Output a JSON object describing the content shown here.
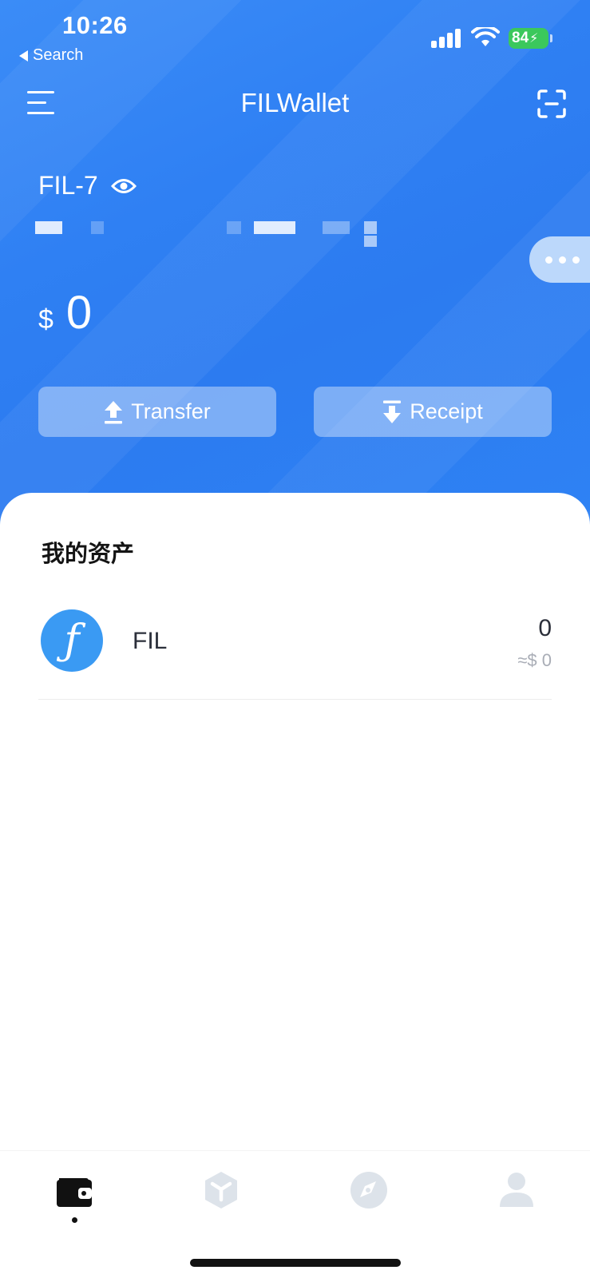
{
  "status_bar": {
    "time": "10:26",
    "back_label": "Search",
    "battery": "84"
  },
  "header": {
    "title": "FILWallet",
    "menu_icon": "menu-icon",
    "scan_icon": "scan-icon"
  },
  "account": {
    "name": "FIL-7",
    "visibility_icon": "eye-icon",
    "currency_symbol": "$",
    "balance": "0"
  },
  "actions": {
    "transfer_label": "Transfer",
    "receipt_label": "Receipt"
  },
  "assets": {
    "title": "我的资产",
    "items": [
      {
        "symbol": "FIL",
        "amount": "0",
        "fiat": "≈$ 0",
        "logo_glyph": "ƒ"
      }
    ]
  },
  "tabbar": {
    "items": [
      "wallet-icon",
      "apps-icon",
      "compass-icon",
      "profile-icon"
    ],
    "active_index": 0
  },
  "colors": {
    "primary": "#2f80f3",
    "battery": "#3bc85c",
    "logo": "#3a9af3"
  }
}
